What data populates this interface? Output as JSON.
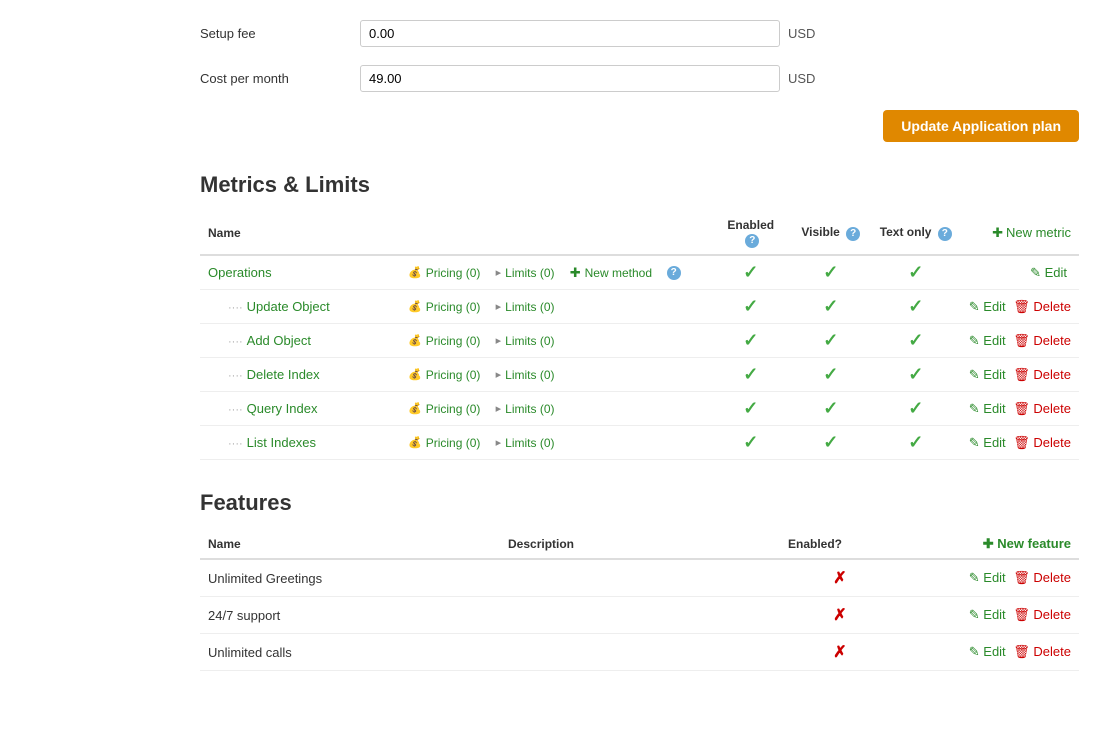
{
  "form": {
    "setup_fee_label": "Setup fee",
    "setup_fee_value": "0.00",
    "setup_fee_currency": "USD",
    "cost_per_month_label": "Cost per month",
    "cost_per_month_value": "49.00",
    "cost_per_month_currency": "USD",
    "update_button_label": "Update Application plan"
  },
  "metrics_section": {
    "title": "Metrics & Limits",
    "columns": {
      "name": "Name",
      "enabled": "Enabled",
      "visible": "Visible",
      "text_only": "Text only",
      "new_metric": "New metric"
    },
    "rows": [
      {
        "name": "Operations",
        "is_sub": false,
        "pricing_label": "Pricing (0)",
        "limits_label": "Limits (0)",
        "new_method_label": "New method",
        "enabled": true,
        "visible": true,
        "text_only": true,
        "edit_label": "Edit",
        "delete_label": null
      },
      {
        "name": "Update Object",
        "is_sub": true,
        "pricing_label": "Pricing (0)",
        "limits_label": "Limits (0)",
        "new_method_label": null,
        "enabled": true,
        "visible": true,
        "text_only": true,
        "edit_label": "Edit",
        "delete_label": "Delete"
      },
      {
        "name": "Add Object",
        "is_sub": true,
        "pricing_label": "Pricing (0)",
        "limits_label": "Limits (0)",
        "new_method_label": null,
        "enabled": true,
        "visible": true,
        "text_only": true,
        "edit_label": "Edit",
        "delete_label": "Delete"
      },
      {
        "name": "Delete Index",
        "is_sub": true,
        "pricing_label": "Pricing (0)",
        "limits_label": "Limits (0)",
        "new_method_label": null,
        "enabled": true,
        "visible": true,
        "text_only": true,
        "edit_label": "Edit",
        "delete_label": "Delete"
      },
      {
        "name": "Query Index",
        "is_sub": true,
        "pricing_label": "Pricing (0)",
        "limits_label": "Limits (0)",
        "new_method_label": null,
        "enabled": true,
        "visible": true,
        "text_only": true,
        "edit_label": "Edit",
        "delete_label": "Delete"
      },
      {
        "name": "List Indexes",
        "is_sub": true,
        "pricing_label": "Pricing (0)",
        "limits_label": "Limits (0)",
        "new_method_label": null,
        "enabled": true,
        "visible": true,
        "text_only": true,
        "edit_label": "Edit",
        "delete_label": "Delete"
      }
    ]
  },
  "features_section": {
    "title": "Features",
    "columns": {
      "name": "Name",
      "description": "Description",
      "enabled": "Enabled?",
      "new_feature": "New feature"
    },
    "rows": [
      {
        "name": "Unlimited Greetings",
        "description": "",
        "enabled": false,
        "edit_label": "Edit",
        "delete_label": "Delete"
      },
      {
        "name": "24/7 support",
        "description": "",
        "enabled": false,
        "edit_label": "Edit",
        "delete_label": "Delete"
      },
      {
        "name": "Unlimited calls",
        "description": "",
        "enabled": false,
        "edit_label": "Edit",
        "delete_label": "Delete"
      }
    ]
  }
}
